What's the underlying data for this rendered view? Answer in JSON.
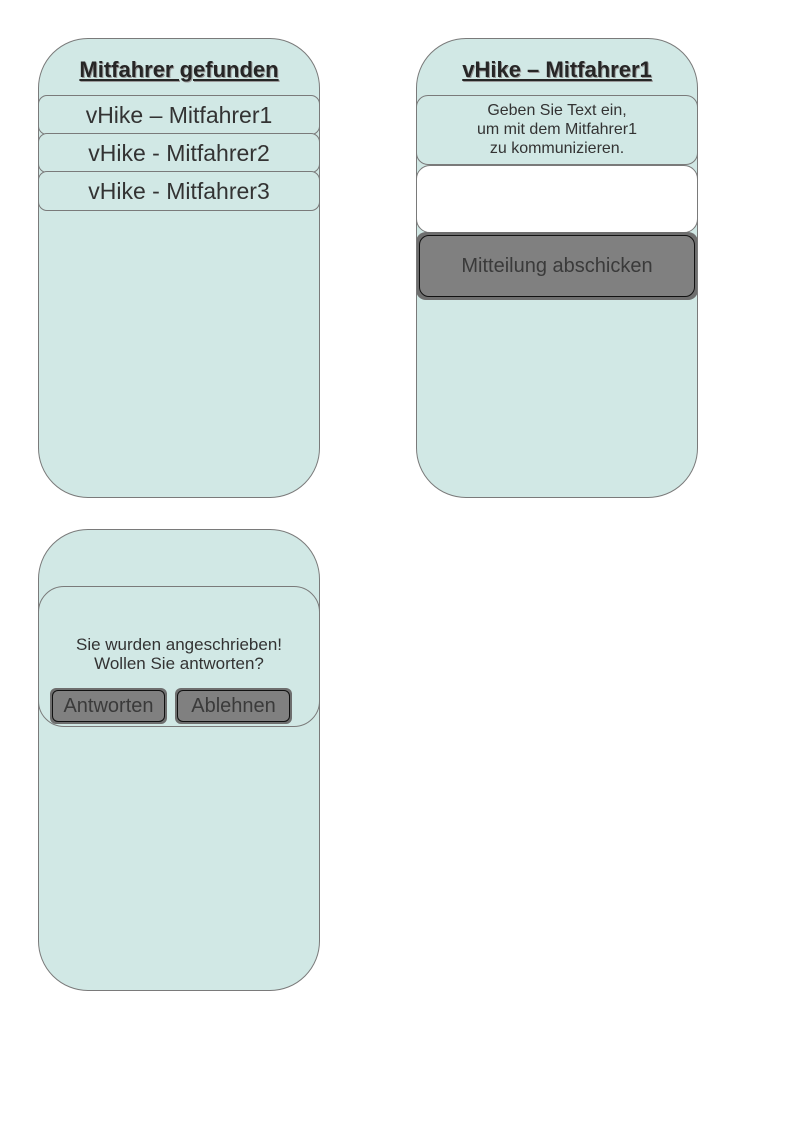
{
  "screen_found": {
    "title": "Mitfahrer gefunden",
    "items": [
      {
        "label": "vHike – Mitfahrer1"
      },
      {
        "label": "vHike - Mitfahrer2"
      },
      {
        "label": "vHike - Mitfahrer3"
      }
    ]
  },
  "screen_chat": {
    "title": "vHike – Mitfahrer1",
    "info_lines": [
      "Geben Sie Text ein,",
      "um mit dem Mitfahrer1",
      "zu kommunizieren."
    ],
    "message_value": "",
    "send_label": "Mitteilung abschicken"
  },
  "screen_notify": {
    "message_lines": [
      "Sie wurden angeschrieben!",
      "Wollen Sie antworten?"
    ],
    "reply_label": "Antworten",
    "decline_label": "Ablehnen"
  },
  "colors": {
    "panel_background": "#d1e8e5",
    "button_background": "#808080",
    "outline": "#7a7a7a"
  }
}
